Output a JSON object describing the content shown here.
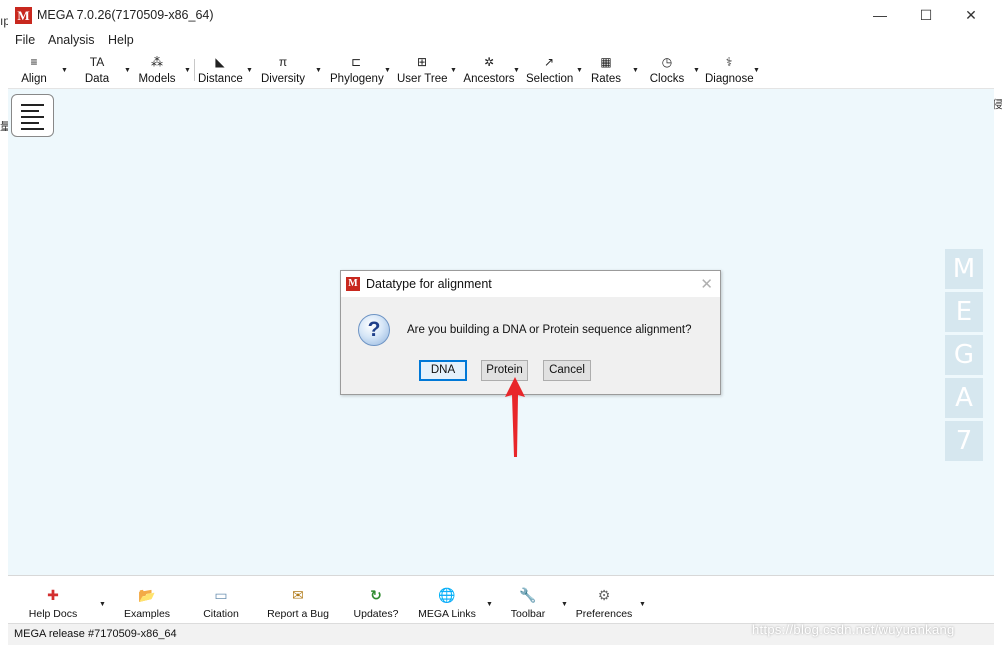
{
  "window": {
    "title": "MEGA 7.0.26(7170509-x86_64)",
    "logo_letter": "M",
    "minimize": "—",
    "maximize": "☐",
    "close": "✕"
  },
  "menubar": [
    "File",
    "Analysis",
    "Help"
  ],
  "toolbar": [
    {
      "label": "Align",
      "icon": "≡"
    },
    {
      "label": "Data",
      "icon": "TA"
    },
    {
      "label": "Models",
      "icon": "⁂"
    },
    {
      "label": "Distance",
      "icon": "◣"
    },
    {
      "label": "Diversity",
      "icon": "π"
    },
    {
      "label": "Phylogeny",
      "icon": "⊏"
    },
    {
      "label": "User Tree",
      "icon": "⊞"
    },
    {
      "label": "Ancestors",
      "icon": "✲"
    },
    {
      "label": "Selection",
      "icon": "↗"
    },
    {
      "label": "Rates",
      "icon": "▦"
    },
    {
      "label": "Clocks",
      "icon": "◷"
    },
    {
      "label": "Diagnose",
      "icon": "⚕"
    }
  ],
  "side_logo": [
    "M",
    "E",
    "G",
    "A",
    "7"
  ],
  "dialog": {
    "title": "Datatype for alignment",
    "logo_letter": "M",
    "close": "✕",
    "icon": "?",
    "message": "Are you building a DNA or Protein sequence alignment?",
    "buttons": {
      "dna": "DNA",
      "protein": "Protein",
      "cancel": "Cancel"
    }
  },
  "bottom_toolbar": [
    {
      "label": "Help Docs",
      "icon": "✚"
    },
    {
      "label": "Examples",
      "icon": "📂"
    },
    {
      "label": "Citation",
      "icon": "▭"
    },
    {
      "label": "Report a Bug",
      "icon": "✉"
    },
    {
      "label": "Updates?",
      "icon": "↻"
    },
    {
      "label": "MEGA Links",
      "icon": "🌐"
    },
    {
      "label": "Toolbar",
      "icon": "🔧"
    },
    {
      "label": "Preferences",
      "icon": "⚙"
    }
  ],
  "status": "MEGA release #7170509-x86_64",
  "watermark": "https://blog.csdn.net/wuyuankang",
  "edge_fragments": {
    "left_top": "ıp",
    "left_mid": "量",
    "right_mid": "侵"
  },
  "colors": {
    "logo_red": "#c8281e",
    "canvas_bg": "#eef8fc",
    "side_logo_bg": "#d6e7ef",
    "focus_blue": "#0078d7",
    "annotation_red": "#e8262a"
  }
}
